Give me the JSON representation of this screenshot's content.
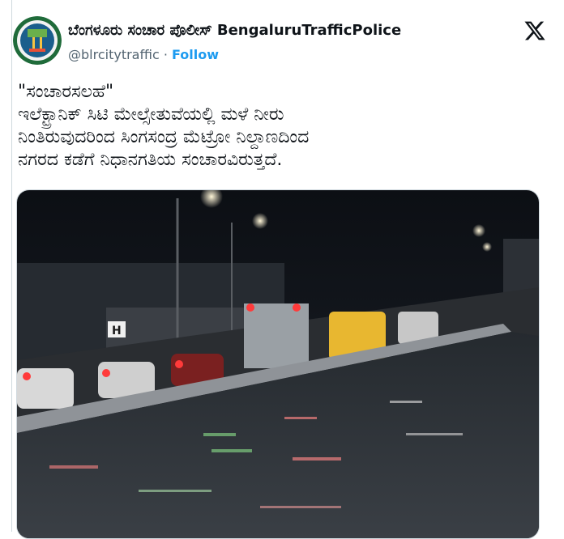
{
  "tweet": {
    "display_name": "ಬೆಂಗಳೂರು ಸಂಚಾರ ಪೊಲೀಸ್ BengaluruTrafficPolice",
    "handle": "@blrcitytraffic",
    "separator": "·",
    "follow_label": "Follow",
    "text": "\"ಸಂಚಾರಸಲಹೆ\"\nಇಲೆಕ್ಟ್ರಾನಿಕ್ ಸಿಟಿ ಮೇಲ್ಸೇತುವೆಯಲ್ಲಿ ಮಳೆ ನೀರು\nನಿಂತಿರುವುದರಿಂದ ಸಿಂಗಸಂದ್ರ ಮೆಟ್ರೋ ನಿಲ್ದಾಣದಿಂದ\nನಗರದ ಕಡೆಗೆ ನಿಧಾನಗತಿಯ ಸಂಚಾರವಿರುತ್ತದೆ.",
    "media_sign_letter": "H",
    "logo_icon": "x-logo-icon",
    "colors": {
      "accent": "#1d9bf0",
      "muted": "#536471",
      "text": "#0f1419"
    }
  }
}
